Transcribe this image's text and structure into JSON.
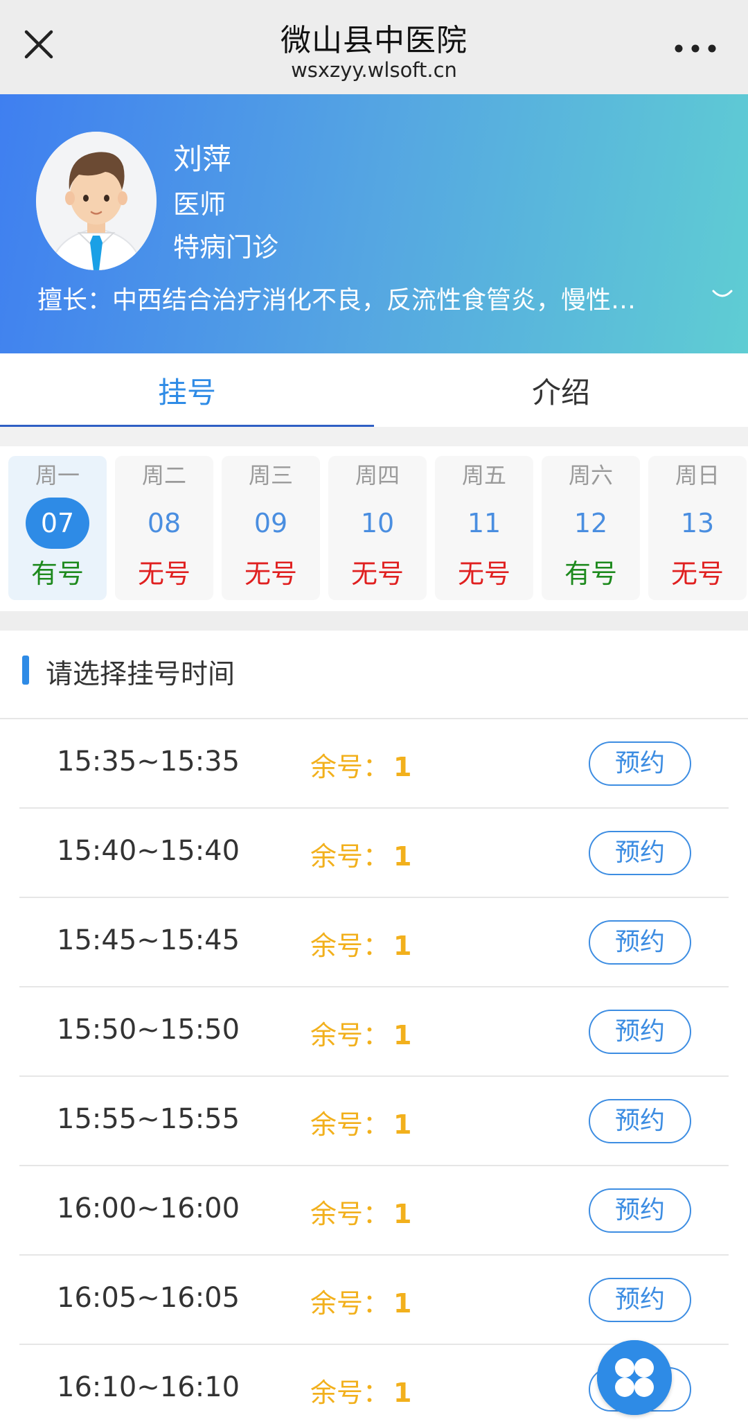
{
  "navbar": {
    "title": "微山县中医院",
    "subtitle": "wsxzyy.wlsoft.cn",
    "close_icon": "close-icon",
    "more_icon": "more-dots-icon"
  },
  "doctor": {
    "name": "刘萍",
    "title": "医师",
    "department": "特病门诊",
    "specialty": "擅长：中西结合治疗消化不良，反流性食管炎，慢性…",
    "expand_icon": "chevron-down-icon"
  },
  "tabs": [
    {
      "label": "挂号",
      "active": true
    },
    {
      "label": "介绍",
      "active": false
    }
  ],
  "days": [
    {
      "weekday": "周一",
      "date": "07",
      "status": "有号",
      "selected": true
    },
    {
      "weekday": "周二",
      "date": "08",
      "status": "无号",
      "selected": false
    },
    {
      "weekday": "周三",
      "date": "09",
      "status": "无号",
      "selected": false
    },
    {
      "weekday": "周四",
      "date": "10",
      "status": "无号",
      "selected": false
    },
    {
      "weekday": "周五",
      "date": "11",
      "status": "无号",
      "selected": false
    },
    {
      "weekday": "周六",
      "date": "12",
      "status": "有号",
      "selected": false
    },
    {
      "weekday": "周日",
      "date": "13",
      "status": "无号",
      "selected": false
    }
  ],
  "section": {
    "title": "请选择挂号时间"
  },
  "slots": [
    {
      "time": "15:35~15:35",
      "remain_label": "余号：",
      "remain": "1",
      "button": "预约"
    },
    {
      "time": "15:40~15:40",
      "remain_label": "余号：",
      "remain": "1",
      "button": "预约"
    },
    {
      "time": "15:45~15:45",
      "remain_label": "余号：",
      "remain": "1",
      "button": "预约"
    },
    {
      "time": "15:50~15:50",
      "remain_label": "余号：",
      "remain": "1",
      "button": "预约"
    },
    {
      "time": "15:55~15:55",
      "remain_label": "余号：",
      "remain": "1",
      "button": "预约"
    },
    {
      "time": "16:00~16:00",
      "remain_label": "余号：",
      "remain": "1",
      "button": "预约"
    },
    {
      "time": "16:05~16:05",
      "remain_label": "余号：",
      "remain": "1",
      "button": "预约"
    },
    {
      "time": "16:10~16:10",
      "remain_label": "余号：",
      "remain": "1",
      "button": "预约"
    }
  ],
  "colors": {
    "accent": "#2e8be6",
    "available": "#1e8a1e",
    "unavailable": "#e02020",
    "remain": "#f2b01c"
  },
  "fab_icon": "four-petal-menu-icon"
}
